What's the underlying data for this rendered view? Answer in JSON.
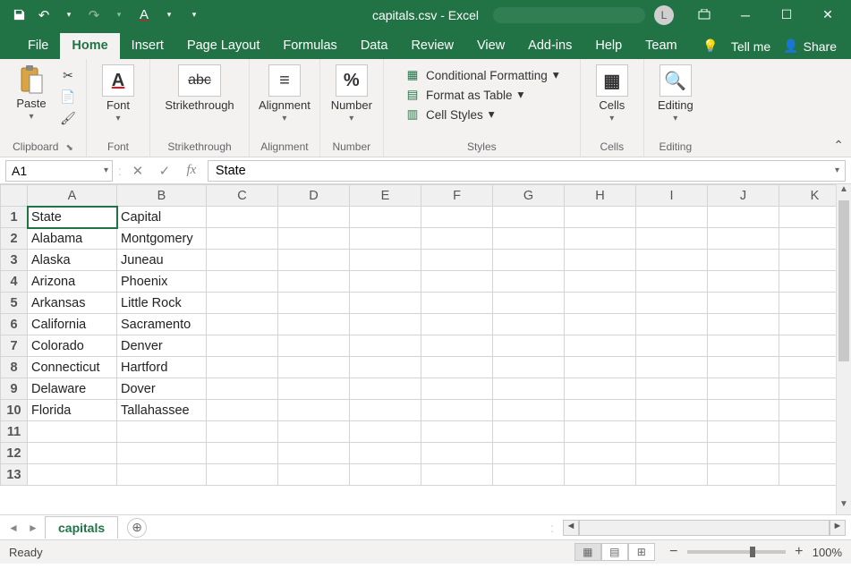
{
  "title": {
    "filename": "capitals.csv",
    "suffix": " - Excel",
    "avatar_initial": "L"
  },
  "menubar": {
    "tabs": [
      "File",
      "Home",
      "Insert",
      "Page Layout",
      "Formulas",
      "Data",
      "Review",
      "View",
      "Add-ins",
      "Help",
      "Team"
    ],
    "active_index": 1,
    "tellme": "Tell me",
    "share": "Share"
  },
  "ribbon": {
    "clipboard": {
      "label": "Clipboard",
      "paste": "Paste"
    },
    "font": {
      "label": "Font",
      "btn": "Font",
      "glyph": "A"
    },
    "strike": {
      "label": "Strikethrough",
      "btn": "Strikethrough",
      "glyph": "abc"
    },
    "alignment": {
      "label": "Alignment",
      "btn": "Alignment",
      "glyph": "≡"
    },
    "number": {
      "label": "Number",
      "btn": "Number",
      "glyph": "%"
    },
    "styles": {
      "label": "Styles",
      "cond": "Conditional Formatting",
      "table": "Format as Table",
      "cell": "Cell Styles"
    },
    "cells": {
      "label": "Cells",
      "btn": "Cells"
    },
    "editing": {
      "label": "Editing",
      "btn": "Editing"
    }
  },
  "formulabar": {
    "namebox": "A1",
    "formula": "State"
  },
  "grid": {
    "columns": [
      "A",
      "B",
      "C",
      "D",
      "E",
      "F",
      "G",
      "H",
      "I",
      "J",
      "K"
    ],
    "row_count": 13,
    "active_cell": "A1",
    "data": [
      [
        "State",
        "Capital"
      ],
      [
        "Alabama",
        "Montgomery"
      ],
      [
        "Alaska",
        "Juneau"
      ],
      [
        "Arizona",
        "Phoenix"
      ],
      [
        "Arkansas",
        "Little Rock"
      ],
      [
        "California",
        "Sacramento"
      ],
      [
        "Colorado",
        "Denver"
      ],
      [
        "Connecticut",
        "Hartford"
      ],
      [
        "Delaware",
        "Dover"
      ],
      [
        "Florida",
        "Tallahassee"
      ]
    ]
  },
  "sheettabs": {
    "active": "capitals"
  },
  "statusbar": {
    "status": "Ready",
    "zoom": "100%"
  }
}
